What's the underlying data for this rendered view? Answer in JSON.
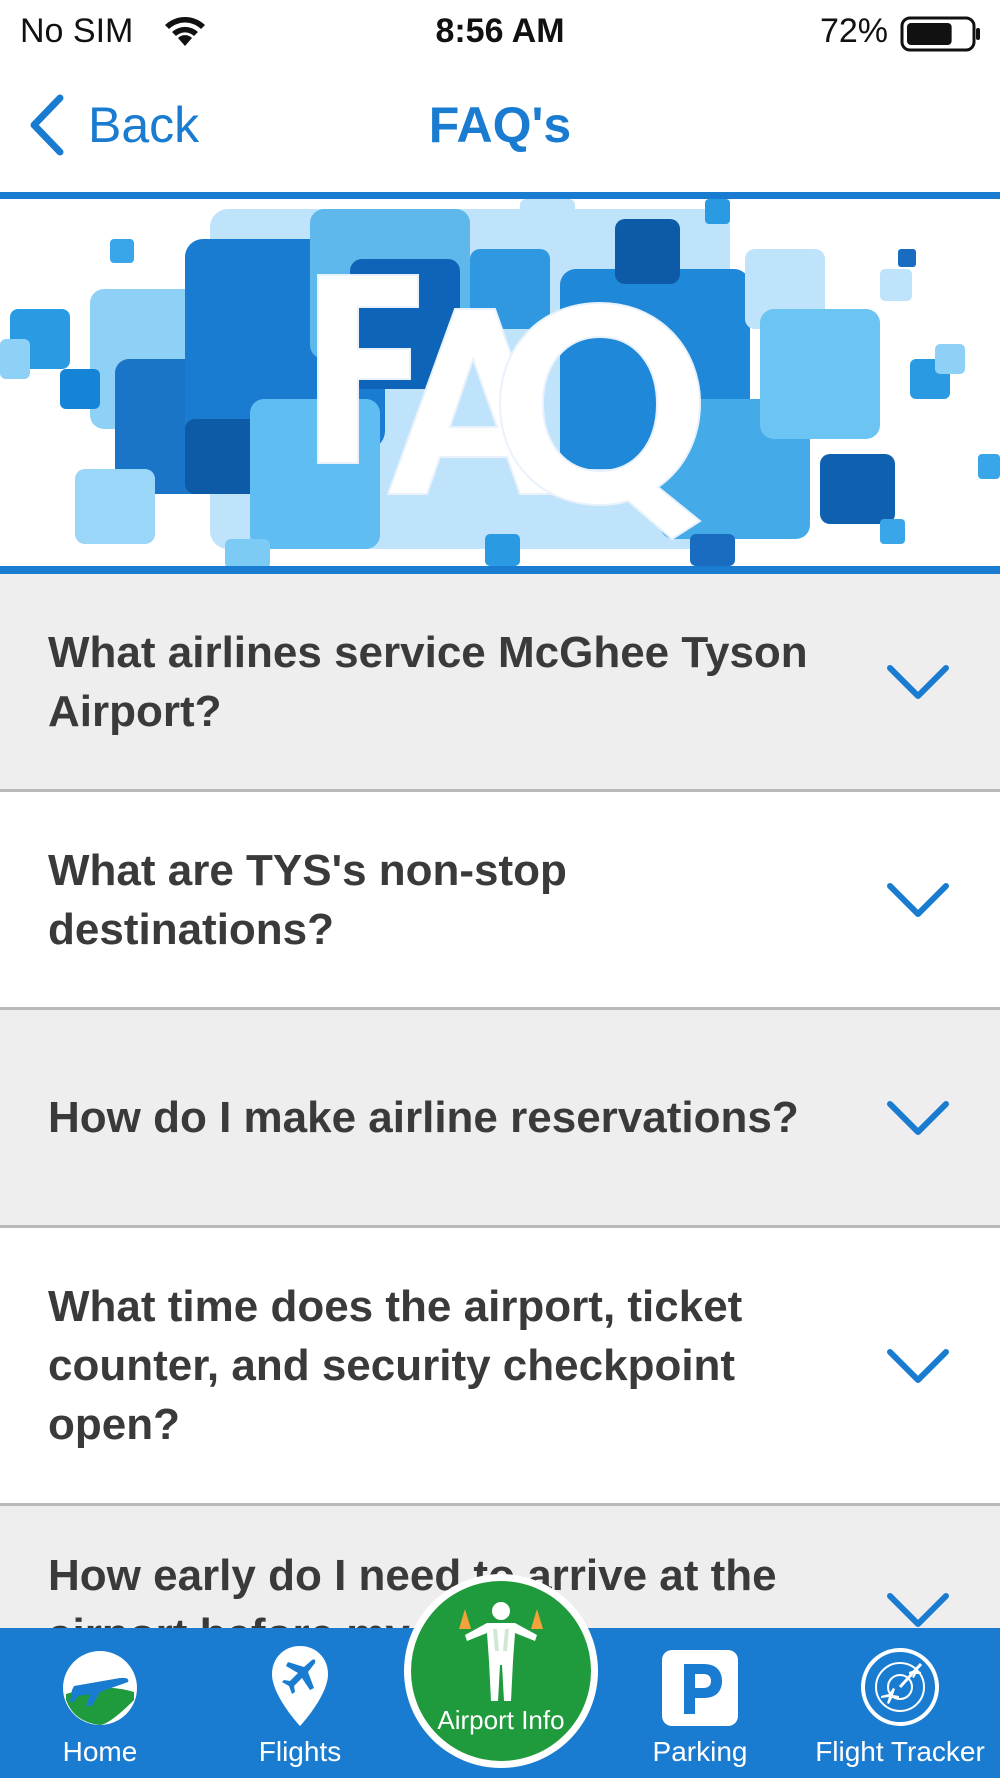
{
  "status_bar": {
    "carrier": "No SIM",
    "time": "8:56 AM",
    "battery_percent": "72%",
    "battery_level": 0.72,
    "icons": [
      "wifi-icon",
      "battery-icon"
    ]
  },
  "nav": {
    "back_label": "Back",
    "title": "FAQ's"
  },
  "banner": {
    "text": "FAQ"
  },
  "faq": {
    "items": [
      {
        "question": "What airlines service McGhee Tyson Airport?"
      },
      {
        "question": "What are TYS's non-stop destinations?"
      },
      {
        "question": "How do I make airline reservations?"
      },
      {
        "question": "What time does the airport, ticket counter, and security checkpoint open?"
      },
      {
        "question": "How early do I need to arrive at the airport before my flight?"
      }
    ]
  },
  "tab_bar": {
    "home": {
      "label": "Home",
      "icon": "plane-globe-icon"
    },
    "flights": {
      "label": "Flights",
      "icon": "plane-pin-icon"
    },
    "airport_info": {
      "label": "Airport Info",
      "icon": "ground-crew-icon"
    },
    "parking": {
      "label": "Parking",
      "icon": "parking-icon"
    },
    "flight_tracker": {
      "label": "Flight Tracker",
      "icon": "radar-icon"
    }
  },
  "colors": {
    "accent": "#1a7cd0",
    "row_shaded": "#eeeeee",
    "text": "#3a3a3a",
    "airport_info_green": "#1f9a3c"
  }
}
